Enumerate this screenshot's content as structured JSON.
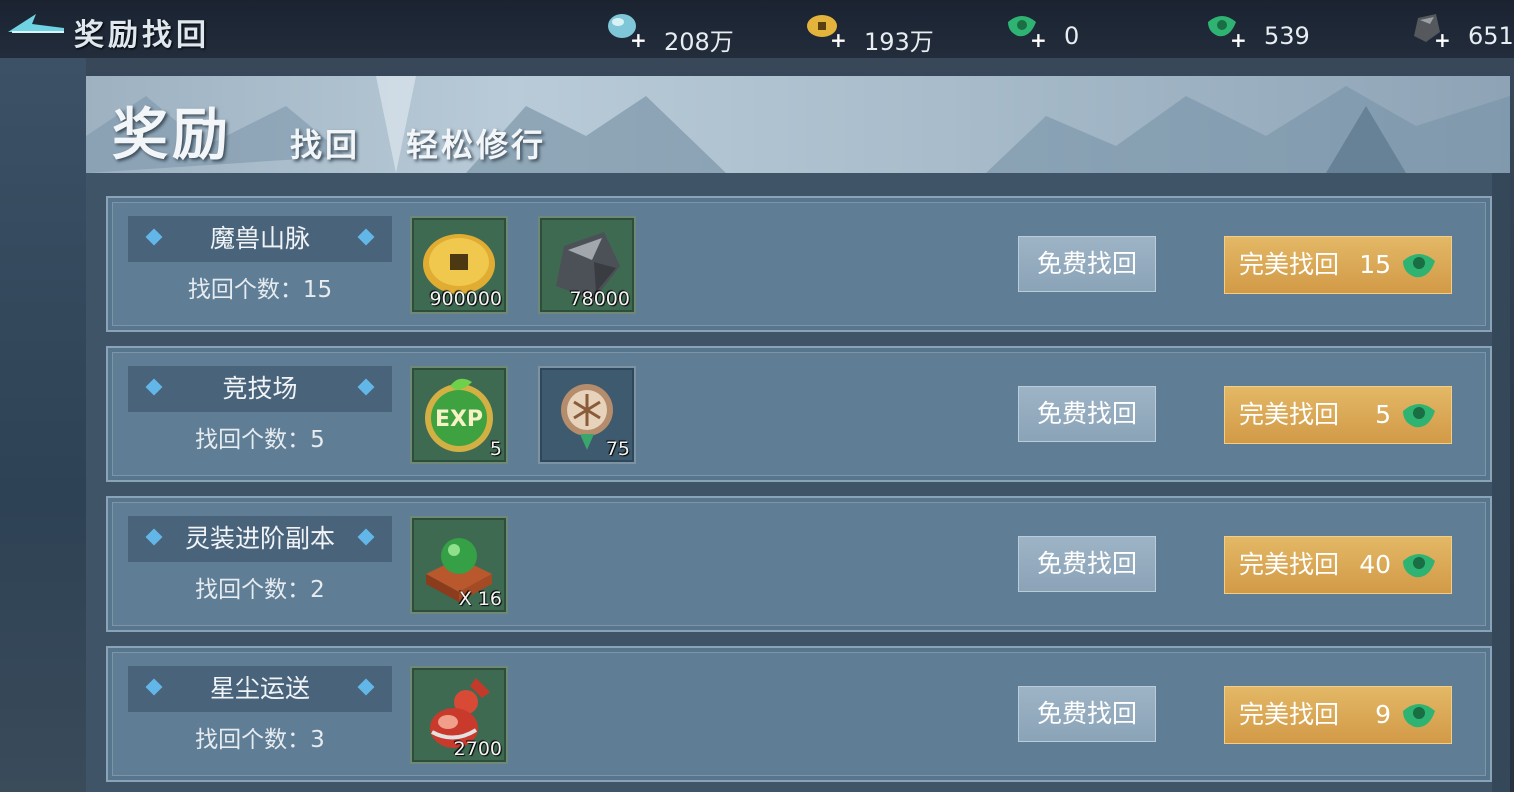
{
  "header": {
    "title": "奖励找回",
    "currencies": [
      {
        "icon": "blue-jade-icon",
        "value": "208万"
      },
      {
        "icon": "copper-coin-icon",
        "value": "193万"
      },
      {
        "icon": "green-jade-icon",
        "value": "0"
      },
      {
        "icon": "green-jade-icon",
        "value": "539"
      },
      {
        "icon": "black-stone-icon",
        "value": "651"
      }
    ]
  },
  "banner": {
    "big": "奖励",
    "sub": "找回",
    "slogan": "轻松修行"
  },
  "rows": [
    {
      "name": "魔兽山脉",
      "count_text": "找回个数：15",
      "items": [
        {
          "icon": "copper-coin-icon",
          "qty": "900000"
        },
        {
          "icon": "black-stone-icon",
          "qty": "78000"
        }
      ],
      "free_label": "免费找回",
      "perfect_label": "完美找回",
      "perfect_cost": "15"
    },
    {
      "name": "竞技场",
      "count_text": "找回个数：5",
      "items": [
        {
          "icon": "exp-orb-icon",
          "qty": "5"
        },
        {
          "icon": "arena-medal-icon",
          "qty": "75"
        }
      ],
      "free_label": "免费找回",
      "perfect_label": "完美找回",
      "perfect_cost": "5"
    },
    {
      "name": "灵装进阶副本",
      "count_text": "找回个数：2",
      "items": [
        {
          "icon": "treasure-chest-icon",
          "qty": "X 16"
        }
      ],
      "free_label": "免费找回",
      "perfect_label": "完美找回",
      "perfect_cost": "40"
    },
    {
      "name": "星尘运送",
      "count_text": "找回个数：3",
      "items": [
        {
          "icon": "potion-gourd-icon",
          "qty": "2700"
        }
      ],
      "free_label": "免费找回",
      "perfect_label": "完美找回",
      "perfect_cost": "9"
    }
  ],
  "colors": {
    "perfect_button": "#d9a452",
    "free_button": "#93abbf",
    "row_bg": "#5f7e96"
  }
}
